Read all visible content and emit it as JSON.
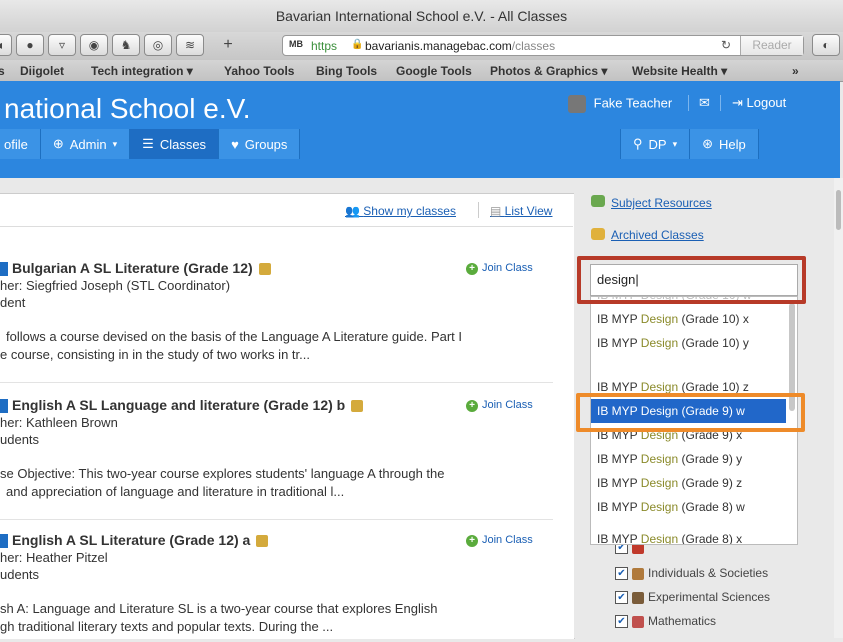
{
  "window": {
    "title": "Bavarian International School e.V. - All Classes"
  },
  "browser": {
    "url_prefix": "MB",
    "url_scheme": "https",
    "url_host": "bavarianis.managebac.com",
    "url_path": "/classes",
    "reader_label": "Reader",
    "bookmarks": [
      "s",
      "Diigolet",
      "Tech integration ▾",
      "Yahoo Tools",
      "Bing Tools",
      "Google Tools",
      "Photos & Graphics ▾",
      "Website Health ▾",
      "»"
    ]
  },
  "header": {
    "school_name": "national School e.V.",
    "user_name": "Fake Teacher",
    "logout_label": "Logout",
    "nav": [
      "ofile",
      "Admin",
      "Classes",
      "Groups"
    ],
    "program_label": "DP",
    "help_label": "Help"
  },
  "toolbar": {
    "show_my_classes": "Show my classes",
    "list_view": "List View"
  },
  "classes": [
    {
      "name": "Bulgarian A SL Literature (Grade 12)",
      "teacher": "her: Siegfried Joseph (STL Coordinator)",
      "students": "dent",
      "desc1": "follows a course devised on the basis of the Language A Literature guide. Part I",
      "desc2": "e course, consisting in in the study of two works in tr...",
      "join_label": "Join Class"
    },
    {
      "name": "English A SL Language and literature (Grade 12) b",
      "teacher": "her: Kathleen Brown",
      "students": "udents",
      "desc1": "se Objective: This two-year course explores students' language A through the",
      "desc2": "and appreciation of language and literature in traditional l...",
      "join_label": "Join Class"
    },
    {
      "name": "English A SL Literature (Grade 12) a",
      "teacher": "her: Heather Pitzel",
      "students": "udents",
      "desc1": "sh A: Language and Literature SL is a two-year course that explores English",
      "desc2": "gh traditional literary texts and popular texts. During the ...",
      "join_label": "Join Class"
    }
  ],
  "sidebar": {
    "subject_resources": "Subject Resources",
    "archived_classes": "Archived Classes",
    "search_value": "design",
    "dropdown": [
      {
        "pre": "IB MYP ",
        "hl": "Design",
        "post": " (Grade 10) x"
      },
      {
        "pre": "IB MYP ",
        "hl": "Design",
        "post": " (Grade 10) y"
      },
      {
        "pre": "IB MYP ",
        "hl": "Design",
        "post": " (Grade 10) z"
      },
      {
        "pre": "IB MYP ",
        "hl": "Design",
        "post": " (Grade 9) w"
      },
      {
        "pre": "IB MYP ",
        "hl": "Design",
        "post": " (Grade 9) x"
      },
      {
        "pre": "IB MYP ",
        "hl": "Design",
        "post": " (Grade 9) y"
      },
      {
        "pre": "IB MYP ",
        "hl": "Design",
        "post": " (Grade 9) z"
      },
      {
        "pre": "IB MYP ",
        "hl": "Design",
        "post": " (Grade 8) w"
      },
      {
        "pre": "IB MYP ",
        "hl": "Design",
        "post": " (Grade 8) x"
      }
    ],
    "selected_index": 3,
    "subjects": [
      "Individuals & Societies",
      "Experimental Sciences",
      "Mathematics"
    ]
  },
  "colors": {
    "header_blue": "#2c86df",
    "highlight_red": "#b73a28",
    "highlight_orange": "#ee8b2a",
    "selection_blue": "#2167c9"
  }
}
